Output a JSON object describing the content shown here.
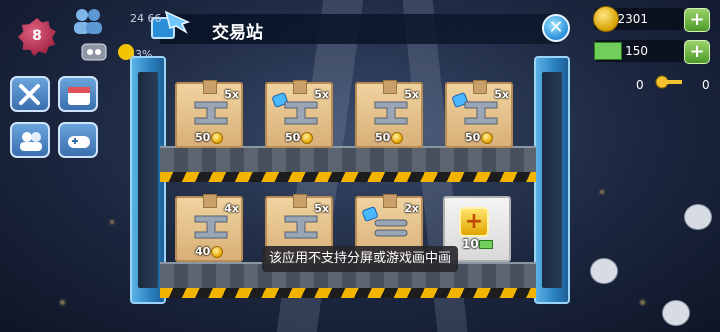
{
  "header": {
    "title": "交易站"
  },
  "left_hud": {
    "level": "8",
    "population": "24 66",
    "percent": "83%"
  },
  "right_hud": {
    "simoleons": "2301",
    "simcash": "150",
    "keys": "0",
    "extra": "0"
  },
  "shelf_top": [
    {
      "qty": "5x",
      "price": "50",
      "gem": false
    },
    {
      "qty": "5x",
      "price": "50",
      "gem": true
    },
    {
      "qty": "5x",
      "price": "50",
      "gem": false
    },
    {
      "qty": "5x",
      "price": "50",
      "gem": true
    }
  ],
  "shelf_bottom": [
    {
      "qty": "4x",
      "price": "40",
      "gem": false
    },
    {
      "qty": "5x",
      "price": "",
      "gem": false
    },
    {
      "qty": "2x",
      "price": "",
      "gem": true
    }
  ],
  "new_slot": {
    "price": "10"
  },
  "toast": "该应用不支持分屏或游戏画中画",
  "colors": {
    "accent_blue": "#2b8fd8",
    "stripe_yellow": "#f2b400",
    "crate": "#e3bf88"
  }
}
